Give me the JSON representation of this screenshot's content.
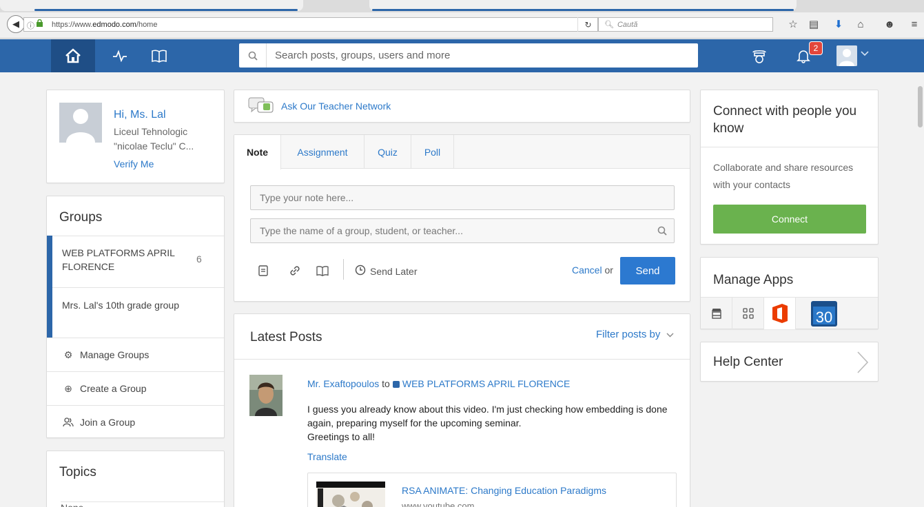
{
  "browser": {
    "url_prefix": "https://www.",
    "url_domain": "edmodo.com",
    "url_path": "/home",
    "search_placeholder": "Caută"
  },
  "header": {
    "search_placeholder": "Search posts, groups, users and more",
    "notification_count": "2",
    "accent": "#2c66a9"
  },
  "profile": {
    "greeting": "Hi, Ms. Lal",
    "school": "Liceul Tehnologic \"nicolae Teclu\" C...",
    "verify": "Verify Me"
  },
  "groups": {
    "title": "Groups",
    "items": [
      {
        "name": "WEB PLATFORMS APRIL FLORENCE",
        "count": "6"
      },
      {
        "name": "Mrs. Lal's 10th grade group",
        "count": ""
      }
    ],
    "actions": [
      "Manage Groups",
      "Create a Group",
      "Join a Group"
    ]
  },
  "topics": {
    "title": "Topics",
    "none": "None"
  },
  "ask_network": "Ask Our Teacher Network",
  "composer": {
    "tabs": [
      "Note",
      "Assignment",
      "Quiz",
      "Poll"
    ],
    "note_placeholder": "Type your note here...",
    "recipient_placeholder": "Type the name of a group, student, or teacher...",
    "send_later": "Send Later",
    "cancel": "Cancel",
    "or": "or",
    "send": "Send"
  },
  "posts": {
    "title": "Latest Posts",
    "filter": "Filter posts by",
    "item": {
      "author": "Mr. Exaftopoulos",
      "to": "to",
      "group": "WEB PLATFORMS APRIL FLORENCE",
      "body_line1": "I guess you already know about this video. I'm just checking how embedding is done again, preparing myself for the upcoming seminar.",
      "body_line2": "Greetings to all!",
      "translate": "Translate",
      "embed_title": "RSA ANIMATE: Changing Education Paradigms",
      "embed_source": "www.youtube.com"
    }
  },
  "connect": {
    "title": "Connect with people you know",
    "desc": "Collaborate and share resources with your contacts",
    "button": "Connect",
    "button_color": "#6ab24e"
  },
  "apps": {
    "title": "Manage Apps",
    "calendar_day": "30"
  },
  "help": {
    "title": "Help Center"
  }
}
